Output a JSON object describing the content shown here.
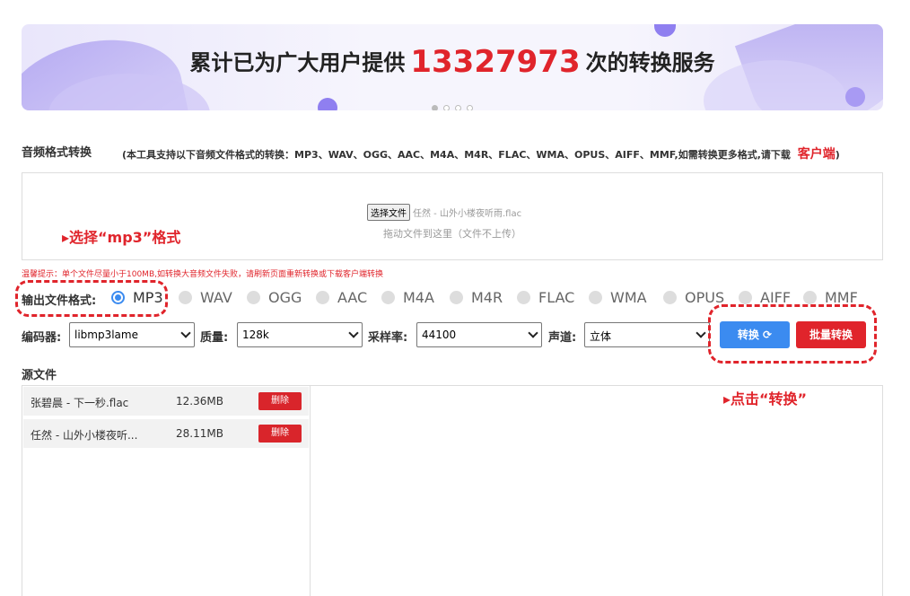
{
  "banner": {
    "text_before": "累计已为广大用户提供",
    "count": "13327973",
    "text_after": "次的转换服务"
  },
  "section": {
    "title": "音频格式转换",
    "desc": "(本工具支持以下音频文件格式的转换：MP3、WAV、OGG、AAC、M4A、M4R、FLAC、WMA、OPUS、AIFF、MMF,如需转换更多格式,请下载",
    "client_link": "客户端",
    "desc_end": ")"
  },
  "dropzone": {
    "choose_button": "选择文件",
    "chosen_file": "任然 - 山外小楼夜听雨.flac",
    "hint": "拖动文件到这里（文件不上传）"
  },
  "annotations": {
    "select_format": "▸选择“mp3”格式",
    "click_convert": "▸点击“转换”"
  },
  "warning": "温馨提示：单个文件尽量小于100MB,如转换大音频文件失败，请刷新页面重新转换或下载客户端转换",
  "format": {
    "label": "输出文件格式:",
    "options": [
      "MP3",
      "WAV",
      "OGG",
      "AAC",
      "M4A",
      "M4R",
      "FLAC",
      "WMA",
      "OPUS",
      "AIFF",
      "MMF"
    ],
    "selected": "MP3"
  },
  "settings": {
    "encoder_label": "编码器:",
    "encoder_value": "libmp3lame",
    "quality_label": "质量:",
    "quality_value": "128k",
    "samplerate_label": "采样率:",
    "samplerate_value": "44100",
    "channel_label": "声道:",
    "channel_value": "立体"
  },
  "buttons": {
    "convert": "转换 ⟳",
    "batch_convert": "批量转换"
  },
  "source": {
    "title": "源文件",
    "files": [
      {
        "name": "张碧晨 - 下一秒.flac",
        "size": "12.36MB",
        "delete": "删除"
      },
      {
        "name": "任然 - 山外小楼夜听...",
        "size": "28.11MB",
        "delete": "删除"
      }
    ]
  }
}
